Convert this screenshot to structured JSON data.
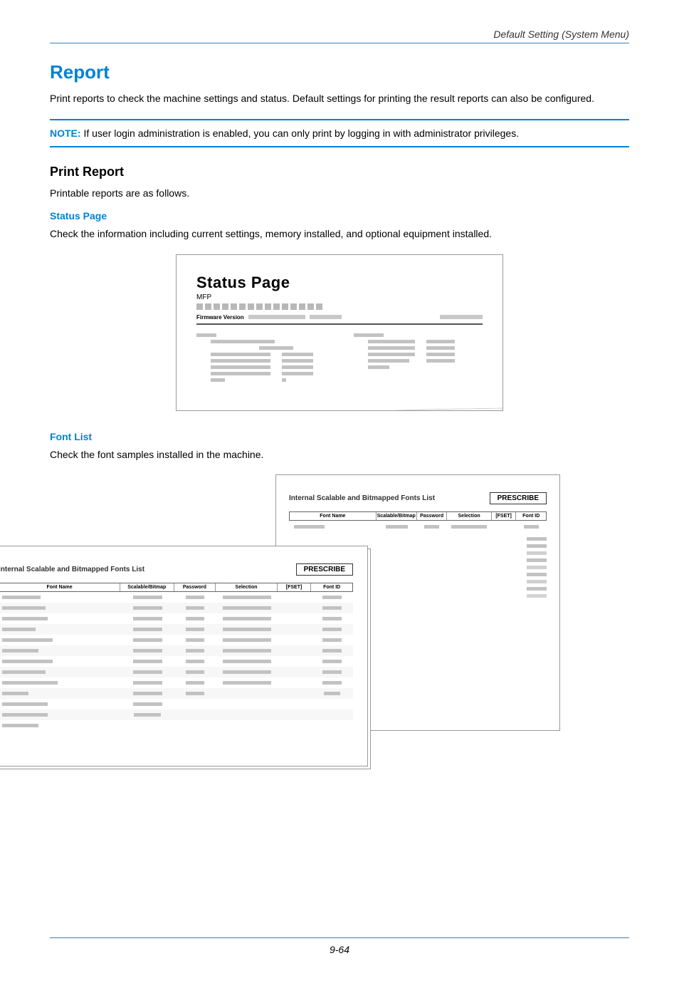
{
  "header": {
    "breadcrumb": "Default Setting (System Menu)"
  },
  "title": "Report",
  "intro": "Print reports to check the machine settings and status. Default settings for printing the result reports can also be configured.",
  "note": {
    "label": "NOTE:",
    "text": " If user login administration is enabled, you can only print by logging in with administrator privileges."
  },
  "printReport": {
    "heading": "Print Report",
    "intro": "Printable reports are as follows."
  },
  "statusPage": {
    "heading": "Status Page",
    "desc": "Check the information including current settings, memory installed, and optional equipment installed.",
    "figure": {
      "title": "Status Page",
      "sub": "MFP",
      "fwLabel": "Firmware Version"
    }
  },
  "fontList": {
    "heading": "Font List",
    "desc": "Check the font samples installed in the machine.",
    "figure": {
      "title": "Internal Scalable and Bitmapped Fonts List",
      "badge": "PRESCRIBE",
      "columns": [
        "Font Name",
        "Scalable/Bitmap",
        "Password",
        "Selection",
        "[FSET]",
        "Font ID"
      ]
    }
  },
  "pageNumber": "9-64"
}
